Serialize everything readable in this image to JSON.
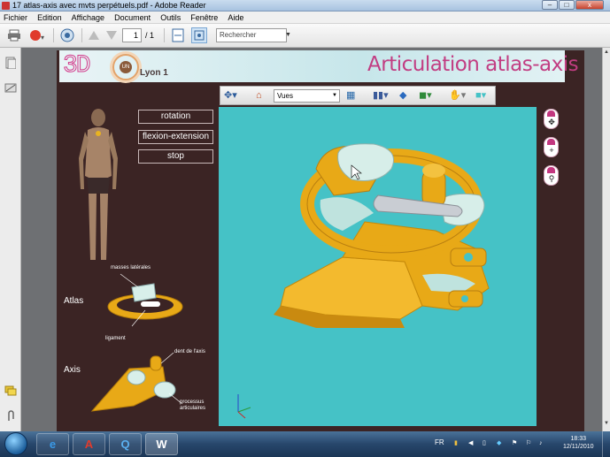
{
  "window": {
    "title": "17 atlas-axis avec mvts perpétuels.pdf - Adobe Reader"
  },
  "window_buttons": {
    "minimize": "–",
    "maximize": "□",
    "close": "x"
  },
  "menu": [
    "Fichier",
    "Edition",
    "Affichage",
    "Document",
    "Outils",
    "Fenêtre",
    "Aide"
  ],
  "toolbar": {
    "page_current": "1",
    "page_total": "/ 1",
    "search_placeholder": "Rechercher"
  },
  "icons": {
    "print": "print-icon",
    "save": "save-icon",
    "share": "share-icon",
    "prev": "page-up-icon",
    "next": "page-down-icon",
    "fit": "fit-page-icon",
    "fullscreen": "fullscreen-icon",
    "pages_panel": "pages-icon",
    "signature_panel": "signature-icon",
    "comments_panel": "comments-icon",
    "attachments_panel": "attachments-icon"
  },
  "document": {
    "logo_text": "3D",
    "lyon": "Lyon 1",
    "uni_badge": "UN",
    "title": "Articulation atlas-axis",
    "buttons": [
      "rotation",
      "flexion-extension",
      "stop"
    ],
    "labels": {
      "atlas": "Atlas",
      "axis": "Axis",
      "masses": "masses latérales",
      "ligament": "ligament",
      "dent": "dent de l'axis",
      "processus": "processus",
      "articulaires": "articulaires"
    },
    "viewer_toolbar": {
      "vues": "Vues"
    }
  },
  "colors": {
    "accent": "#c23d82",
    "viewer_bg": "#45c2c6",
    "bone": "#e8a917",
    "page_bg": "#3b2424"
  },
  "taskbar": {
    "lang": "FR",
    "time": "18:33",
    "date": "12/11/2010",
    "apps": [
      "internet-explorer",
      "acrobat",
      "quicktime",
      "word"
    ],
    "app_glyphs": [
      "e",
      "A",
      "Q",
      "W"
    ]
  }
}
